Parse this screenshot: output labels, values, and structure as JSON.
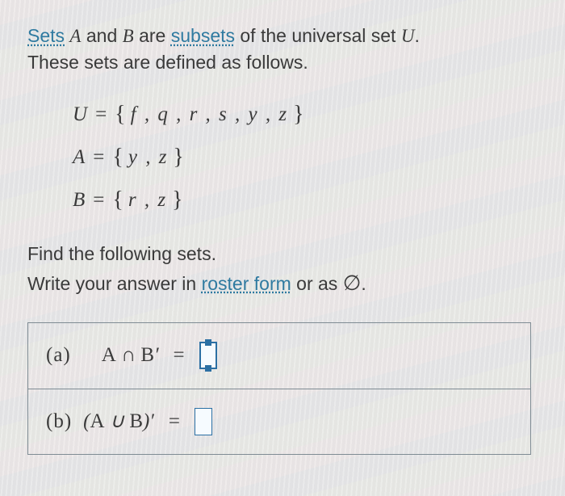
{
  "intro": {
    "sets_link": "Sets",
    "and_word": " and ",
    "are_word": " are ",
    "subsets_link": "subsets",
    "rest1": " of the universal set ",
    "period": ".",
    "line2": "These sets are defined as follows."
  },
  "vars": {
    "A": "A",
    "B": "B",
    "U": "U"
  },
  "definitions": {
    "U": {
      "name": "U",
      "elements": "f , q , r , s , y , z"
    },
    "A": {
      "name": "A",
      "elements": "y , z"
    },
    "B": {
      "name": "B",
      "elements": "r , z"
    }
  },
  "task": {
    "line1": "Find the following sets.",
    "pre": "Write your answer in ",
    "roster_link": "roster form",
    "post": " or as ",
    "empty_symbol": "∅",
    "period": "."
  },
  "questions": {
    "a": {
      "label": "(a)",
      "expr_lhs": "A ∩ B′",
      "eq": "="
    },
    "b": {
      "label": "(b)",
      "expr_lhs": "(A ∪ B)′",
      "eq": "="
    }
  }
}
